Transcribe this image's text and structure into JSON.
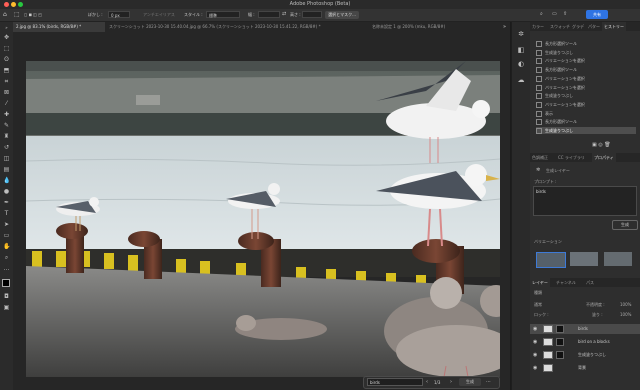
{
  "window": {
    "title": "Adobe Photoshop (Beta)",
    "share_label": "共有"
  },
  "options_bar": {
    "feather_label": "ぼかし :",
    "feather_value": "0 px",
    "antialias_label": "アンチエイリアス",
    "style_label": "スタイル :",
    "style_value": "標準",
    "width_label": "幅 :",
    "height_label": "高さ :",
    "select_mask_label": "選択とマスク..."
  },
  "tabs": [
    {
      "label": "2.jpg @ 83.1% (birds, RGB/8#) *",
      "active": true
    },
    {
      "label": "スクリーンショット 2023-10-30 15.40.04.jpg @ 66.7% (スクリーンショット 2023-10-30 15.41.22, RGB/8#) *",
      "active": false
    },
    {
      "label": "名称未設定 1 @ 200% (mku, RGB/8#)",
      "active": false
    }
  ],
  "history_panel": {
    "tabs": [
      "カラー",
      "スウォッチ",
      "グラデ",
      "パター",
      "ヒストリー"
    ],
    "active_tab": "ヒストリー",
    "items": [
      "長方形選択ツール",
      "生成塗りつぶし",
      "バリエーションを選択",
      "長方形選択ツール",
      "バリエーションを選択",
      "バリエーションを選択",
      "生成塗りつぶし",
      "バリエーションを選択",
      "表示",
      "長方形選択ツール",
      "生成塗りつぶし"
    ],
    "selected_index": 10
  },
  "properties_panel": {
    "tabs": [
      "色調補正",
      "CC ライブラリ",
      "プロパティ"
    ],
    "active_tab": "プロパティ",
    "layer_type": "生成レイヤー",
    "prompt_label": "プロンプト :",
    "prompt_value": "birds",
    "generate_label": "生成",
    "variations_label": "バリエーション"
  },
  "layers_panel": {
    "tabs": [
      "レイヤー",
      "チャンネル",
      "パス"
    ],
    "active_tab": "レイヤー",
    "kind_label": "種類",
    "blend_mode": "通常",
    "opacity_label": "不透明度 :",
    "opacity_value": "100%",
    "lock_label": "ロック :",
    "fill_label": "塗り :",
    "fill_value": "100%",
    "layers": [
      {
        "name": "birds",
        "selected": true
      },
      {
        "name": "bird on a blocks",
        "selected": false
      },
      {
        "name": "生成塗りつぶし",
        "selected": false
      },
      {
        "name": "背景",
        "selected": false
      }
    ]
  },
  "contextual_bar": {
    "prompt_value": "birds",
    "page_counter": "1/3",
    "generate_label": "生成"
  }
}
